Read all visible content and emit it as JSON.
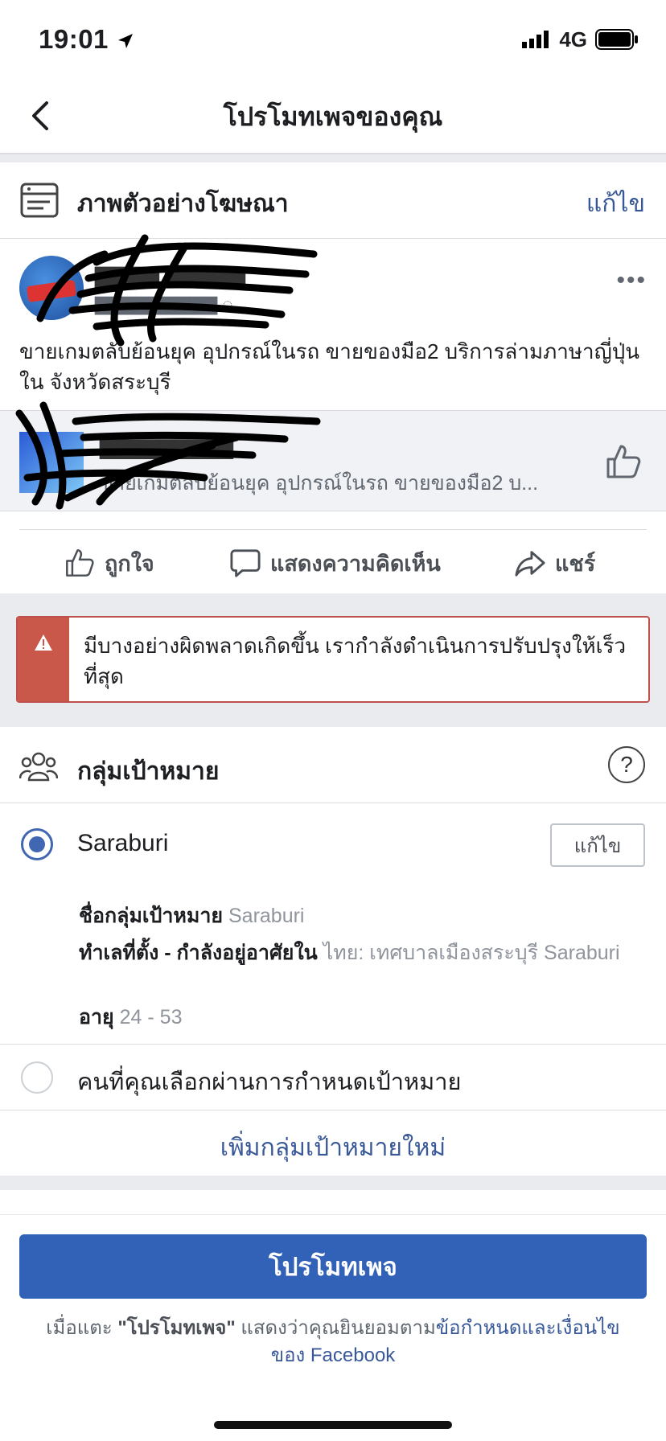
{
  "status_bar": {
    "time": "19:01",
    "network": "4G"
  },
  "nav": {
    "title": "โปรโมทเพจของคุณ"
  },
  "ad_preview": {
    "section_title": "ภาพตัวอย่างโฆษณา",
    "edit_label": "แก้ไข",
    "post_text": "ขายเกมตลับย้อนยุค อุปกรณ์ในรถ ขายของมือ2 บริการล่ามภาษาญี่ปุ่น ใน จังหวัดสระบุรี",
    "link_description": "ขายเกมตลับย้อนยุค อุปกรณ์ในรถ ขายของมือ2 บ...",
    "more_label": "•••"
  },
  "actions": {
    "like": "ถูกใจ",
    "comment": "แสดงความคิดเห็น",
    "share": "แชร์"
  },
  "alert": {
    "message": "มีบางอย่างผิดพลาดเกิดขึ้น เรากำลังดำเนินการปรับปรุงให้เร็วที่สุด"
  },
  "audience": {
    "section_title": "กลุ่มเป้าหมาย",
    "help_label": "?",
    "selected": {
      "name": "Saraburi",
      "edit_label": "แก้ไข",
      "name_label": "ชื่อกลุ่มเป้าหมาย",
      "name_value": "Saraburi",
      "location_label": "ทำเลที่ตั้ง - กำลังอยู่อาศัยใน",
      "location_value": "ไทย: เทศบาลเมืองสระบุรี Saraburi",
      "age_label": "อายุ",
      "age_value": "24 - 53"
    },
    "custom_option": "คนที่คุณเลือกผ่านการกำหนดเป้าหมาย",
    "add_new": "เพิ่มกลุ่มเป้าหมายใหม่"
  },
  "footer": {
    "promote_button": "โปรโมทเพจ",
    "terms_prefix": "เมื่อแตะ ",
    "terms_quote": "\"โปรโมทเพจ\"",
    "terms_middle": " แสดงว่าคุณยินยอมตาม",
    "terms_link": "ข้อกำหนดและเงื่อนไขของ Facebook"
  },
  "colors": {
    "accent": "#385898",
    "button": "#3262b7",
    "alert": "#c9584a"
  }
}
